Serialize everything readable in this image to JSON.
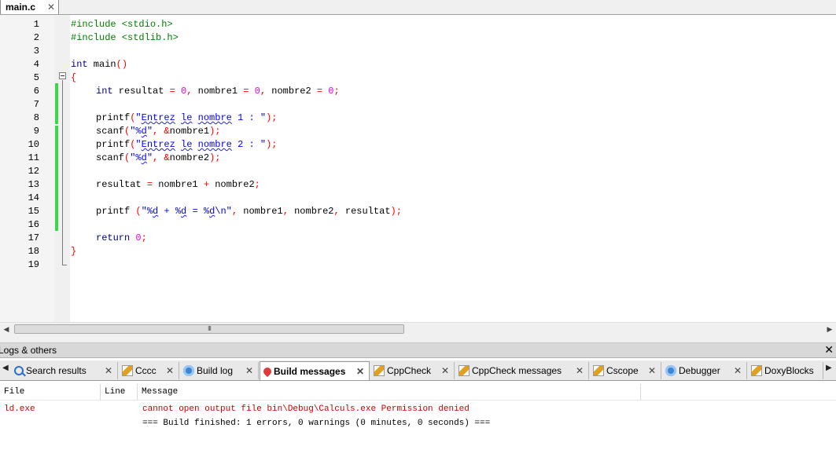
{
  "editor": {
    "file_tab": {
      "label": "main.c",
      "close": "✕"
    },
    "lines": [
      {
        "n": "1"
      },
      {
        "n": "2"
      },
      {
        "n": "3"
      },
      {
        "n": "4"
      },
      {
        "n": "5"
      },
      {
        "n": "6"
      },
      {
        "n": "7"
      },
      {
        "n": "8"
      },
      {
        "n": "9"
      },
      {
        "n": "10"
      },
      {
        "n": "11"
      },
      {
        "n": "12"
      },
      {
        "n": "13"
      },
      {
        "n": "14"
      },
      {
        "n": "15"
      },
      {
        "n": "16"
      },
      {
        "n": "17"
      },
      {
        "n": "18"
      },
      {
        "n": "19"
      }
    ],
    "code": {
      "l1": "#include <stdio.h>",
      "l2": "#include <stdlib.h>",
      "l4_kw": "int",
      "l4_rest": " main",
      "l4_paren": "()",
      "l5": "{",
      "l6_kw": "int",
      "l6_a": " resultat ",
      "l6_eq1": "=",
      "l6_z1": " 0",
      "l6_c1": ",",
      "l6_b": " nombre1 ",
      "l6_eq2": "=",
      "l6_z2": " 0",
      "l6_c2": ",",
      "l6_c": " nombre2 ",
      "l6_eq3": "=",
      "l6_z3": " 0",
      "l6_semi": ";",
      "l8_fn": "printf",
      "l8_p": "(",
      "l8_q": "\"",
      "l8_w1": "Entrez",
      "l8_w2": "le",
      "l8_w3": "nombre",
      "l8_tail": " 1 : \"",
      "l8_end": ");",
      "l9_fn": "scanf",
      "l9_p": "(",
      "l9_q": "\"%",
      "l9_d": "d",
      "l9_q2": "\"",
      "l9_comma": ", &",
      "l9_var": "nombre1",
      "l9_end": ");",
      "l10_fn": "printf",
      "l10_p": "(",
      "l10_q": "\"",
      "l10_w1": "Entrez",
      "l10_w2": "le",
      "l10_w3": "nombre",
      "l10_tail": " 2 : \"",
      "l10_end": ");",
      "l11_fn": "scanf",
      "l11_p": "(",
      "l11_q": "\"%",
      "l11_d": "d",
      "l11_q2": "\"",
      "l11_comma": ", &",
      "l11_var": "nombre2",
      "l11_end": ");",
      "l13_a": "resultat ",
      "l13_eq": "=",
      "l13_b": " nombre1 ",
      "l13_plus": "+",
      "l13_c": " nombre2",
      "l13_semi": ";",
      "l15_fn": "printf ",
      "l15_p": "(",
      "l15_s1": "\"%",
      "l15_d1": "d",
      "l15_s2": " + %",
      "l15_d2": "d",
      "l15_s3": " = %",
      "l15_d3": "d",
      "l15_s4": "\\n\"",
      "l15_c1": ",",
      "l15_v1": " nombre1",
      "l15_c2": ",",
      "l15_v2": " nombre2",
      "l15_c3": ",",
      "l15_v3": " resultat",
      "l15_end": ");",
      "l17_kw": "return",
      "l17_z": " 0",
      "l17_semi": ";",
      "l18": "}"
    },
    "hscroll_grip": "III"
  },
  "logs": {
    "title": "Logs & others",
    "close": "✕",
    "tabs": [
      {
        "label": "Search results",
        "close": "✕"
      },
      {
        "label": "Cccc",
        "close": "✕"
      },
      {
        "label": "Build log",
        "close": "✕"
      },
      {
        "label": "Build messages",
        "close": "✕"
      },
      {
        "label": "CppCheck",
        "close": "✕"
      },
      {
        "label": "CppCheck messages",
        "close": "✕"
      },
      {
        "label": "Cscope",
        "close": "✕"
      },
      {
        "label": "Debugger",
        "close": "✕"
      },
      {
        "label": "DoxyBlocks",
        "close": ""
      }
    ],
    "columns": {
      "file": "File",
      "line": "Line",
      "message": "Message"
    },
    "rows": [
      {
        "file": "ld.exe",
        "line": "",
        "message": "cannot open output file bin\\Debug\\Calculs.exe Permission denied"
      },
      {
        "file": "",
        "line": "",
        "message": "=== Build finished: 1 errors, 0 warnings (0 minutes, 0 seconds) ==="
      }
    ]
  },
  "colors": {
    "keyword": "#000080",
    "preprocessor": "#008000",
    "number": "#f000f0",
    "string": "#0000ff",
    "operator": "#ff0000",
    "change_bar": "#3cd84a",
    "error_text": "#d00000"
  }
}
